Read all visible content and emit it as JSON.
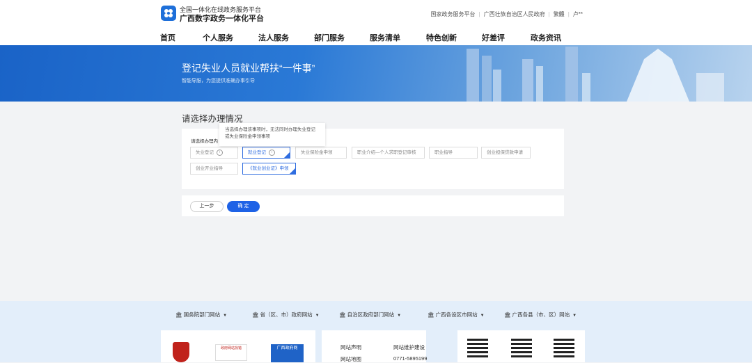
{
  "header": {
    "platform_sub": "全国一体化在线政务服务平台",
    "platform_main": "广西数字政务一体化平台",
    "top_links": [
      "国家政务服务平台",
      "广西壮族自治区人民政府",
      "繁體",
      "卢**"
    ]
  },
  "nav": [
    "首页",
    "个人服务",
    "法人服务",
    "部门服务",
    "服务清单",
    "特色创新",
    "好差评",
    "政务资讯"
  ],
  "banner": {
    "title": "登记失业人员就业帮扶“一件事”",
    "subtitle": "智能导服，为您提供准确办事引导"
  },
  "main": {
    "section_title": "请选择办理情况",
    "label": "请选择办理内",
    "tooltip": "当选择办理该事项时，无法同时办理失业登记或失业保险金申领事项",
    "options_row1": [
      "失业登记",
      "就业登记",
      "失业保险金申领",
      "职业介绍—个人求职登记审核",
      "职业指导",
      "创业担保贷款申请"
    ],
    "options_row2": [
      "创业开业指导",
      "《就业创业证》申领"
    ],
    "prev_button": "上一步",
    "confirm_button": "确 定"
  },
  "footer": {
    "links": [
      "国务院部门网站",
      "省（区、市）政府网站",
      "自治区政府部门网站",
      "广西各设区市网站",
      "广西各县（市、区）网站"
    ],
    "site_links": [
      "网站声明",
      "网站维护建设",
      "网站地图",
      "0771-5895199"
    ],
    "badges": [
      "政府网站找错",
      "广西政府网"
    ]
  },
  "colors": {
    "primary": "#1e62e6",
    "banner": "#2a79d6",
    "footer": "#e3eefa"
  }
}
